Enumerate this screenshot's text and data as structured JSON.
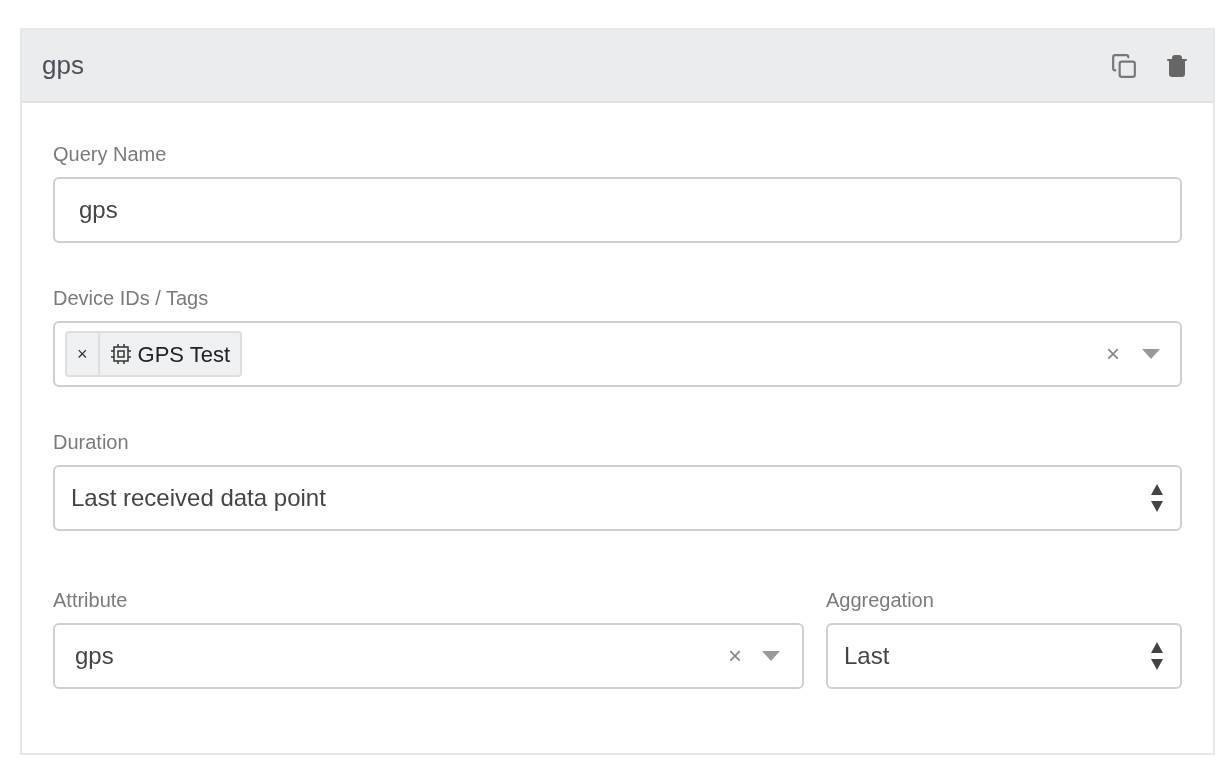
{
  "panel": {
    "title": "gps"
  },
  "query_name": {
    "label": "Query Name",
    "value": "gps"
  },
  "devices": {
    "label": "Device IDs / Tags",
    "tags": [
      {
        "remove": "×",
        "label": "GPS Test"
      }
    ],
    "clear": "×"
  },
  "duration": {
    "label": "Duration",
    "value": "Last received data point"
  },
  "attribute": {
    "label": "Attribute",
    "value": "gps",
    "clear": "×"
  },
  "aggregation": {
    "label": "Aggregation",
    "value": "Last"
  }
}
